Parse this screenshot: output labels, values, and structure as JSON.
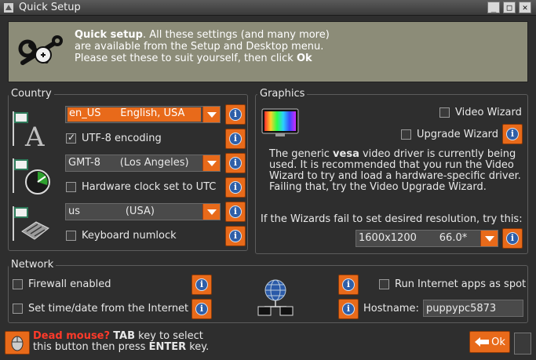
{
  "window": {
    "title": "Quick Setup",
    "buttons": [
      "_",
      "□",
      "✕"
    ]
  },
  "banner": {
    "bold_lead": "Quick setup",
    "line1_rest": ". All these settings (and many more)",
    "line2": "are available from the Setup and Desktop menu.",
    "line3_pre": "Please set these to suit yourself, then click ",
    "line3_bold": "Ok"
  },
  "country": {
    "label": "Country",
    "locale_value": "en_US      English, USA",
    "utf8_label": "UTF-8 encoding",
    "utf8_checked": true,
    "timezone_value": "GMT-8      (Los Angeles)",
    "hwclock_label": "Hardware clock set to UTC",
    "hwclock_checked": false,
    "keyboard_value": "us              (USA)",
    "numlock_label": "Keyboard numlock",
    "numlock_checked": false
  },
  "graphics": {
    "label": "Graphics",
    "video_wizard_label": "Video Wizard",
    "upgrade_wizard_label": "Upgrade Wizard",
    "desc_pre": "The generic ",
    "desc_bold": "vesa",
    "desc_rest": " video driver is currently being used. It is recommended that you run the Video Wizard to try and load a hardware-specific driver. Failing that, try the Video Upgrade Wizard.",
    "hint": "If the Wizards fail to set desired resolution, try this:",
    "resolution_value": "1600x1200       66.0*"
  },
  "network": {
    "label": "Network",
    "firewall_label": "Firewall enabled",
    "timedate_label": "Set time/date from the Internet",
    "spot_label": "Run Internet apps as spot",
    "hostname_label": "Hostname:",
    "hostname_value": "puppypc5873"
  },
  "footer": {
    "dead_mouse": "Dead mouse?",
    "line1_rest_pre": " ",
    "tab_key": "TAB",
    "line1_rest": " key to select",
    "line2_pre": "this button then press ",
    "enter_key": "ENTER",
    "line2_rest": " key.",
    "ok_label": "Ok"
  },
  "colors": {
    "accent": "#e86a1a",
    "banner": "#8c8c78",
    "background": "#2e2e2e"
  }
}
